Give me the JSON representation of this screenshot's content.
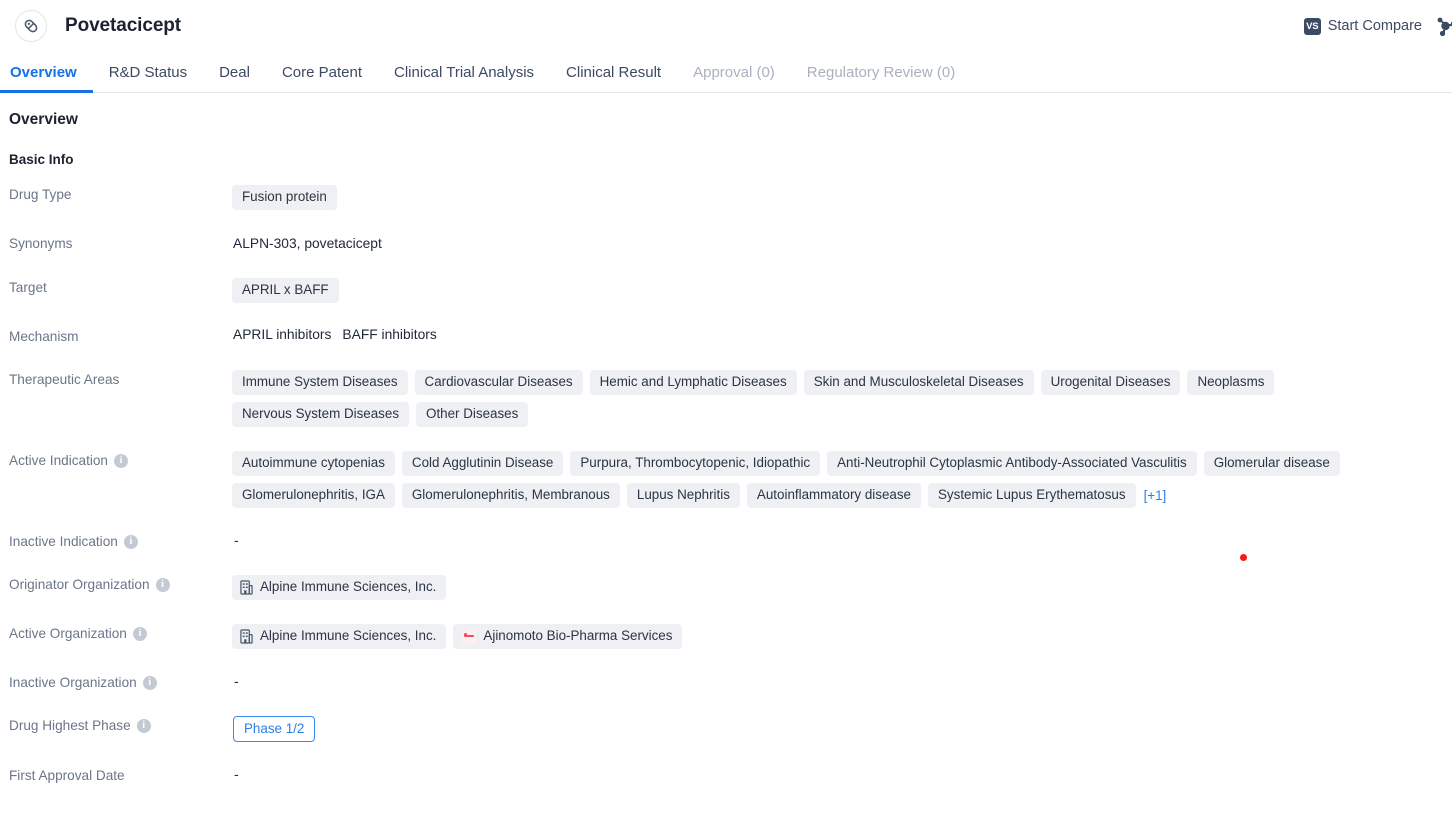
{
  "header": {
    "drug_icon": "pill-icon",
    "title": "Povetacicept",
    "compare_badge": "VS",
    "compare_label": "Start Compare",
    "molecule_icon": "molecule-icon"
  },
  "tabs": [
    {
      "label": "Overview",
      "state": "active"
    },
    {
      "label": "R&D Status",
      "state": "normal"
    },
    {
      "label": "Deal",
      "state": "normal"
    },
    {
      "label": "Core Patent",
      "state": "normal"
    },
    {
      "label": "Clinical Trial Analysis",
      "state": "normal"
    },
    {
      "label": "Clinical Result",
      "state": "normal"
    },
    {
      "label": "Approval (0)",
      "state": "disabled"
    },
    {
      "label": "Regulatory Review (0)",
      "state": "disabled"
    }
  ],
  "content": {
    "section_title": "Overview",
    "subsection_title": "Basic Info",
    "rows": {
      "drug_type": {
        "label": "Drug Type",
        "tags": [
          "Fusion protein"
        ]
      },
      "synonyms": {
        "label": "Synonyms",
        "value": "ALPN-303,  povetacicept"
      },
      "target": {
        "label": "Target",
        "tags": [
          "APRIL x BAFF"
        ]
      },
      "mechanism": {
        "label": "Mechanism",
        "items": [
          "APRIL inhibitors",
          "BAFF inhibitors"
        ]
      },
      "therapeutic_areas": {
        "label": "Therapeutic Areas",
        "tags": [
          "Immune System Diseases",
          "Cardiovascular Diseases",
          "Hemic and Lymphatic Diseases",
          "Skin and Musculoskeletal Diseases",
          "Urogenital Diseases",
          "Neoplasms",
          "Nervous System Diseases",
          "Other Diseases"
        ]
      },
      "active_indication": {
        "label": "Active Indication",
        "has_info": true,
        "tags": [
          "Autoimmune cytopenias",
          "Cold Agglutinin Disease",
          "Purpura, Thrombocytopenic, Idiopathic",
          "Anti-Neutrophil Cytoplasmic Antibody-Associated Vasculitis",
          "Glomerular disease",
          "Glomerulonephritis, IGA",
          "Glomerulonephritis, Membranous",
          "Lupus Nephritis",
          "Autoinflammatory disease",
          "Systemic Lupus Erythematosus"
        ],
        "more_label": "[+1]"
      },
      "inactive_indication": {
        "label": "Inactive Indication",
        "has_info": true,
        "value": "-"
      },
      "originator_organization": {
        "label": "Originator Organization",
        "has_info": true,
        "orgs": [
          {
            "name": "Alpine Immune Sciences, Inc.",
            "logo": "building-icon"
          }
        ]
      },
      "active_organization": {
        "label": "Active Organization",
        "has_info": true,
        "orgs": [
          {
            "name": "Alpine Immune Sciences, Inc.",
            "logo": "building-icon"
          },
          {
            "name": "Ajinomoto Bio-Pharma Services",
            "logo": "ajinomoto-logo-icon"
          }
        ]
      },
      "inactive_organization": {
        "label": "Inactive Organization",
        "has_info": true,
        "value": "-"
      },
      "drug_highest_phase": {
        "label": "Drug Highest Phase",
        "has_info": true,
        "phase": "Phase 1/2"
      },
      "first_approval_date": {
        "label": "First Approval Date",
        "value": "-"
      }
    }
  },
  "colors": {
    "accent_blue": "#1471e8",
    "link_blue": "#2a7fe8",
    "tag_bg": "#eef0f3",
    "label_gray": "#6b7689",
    "cursor_red": "#f41a1a"
  }
}
